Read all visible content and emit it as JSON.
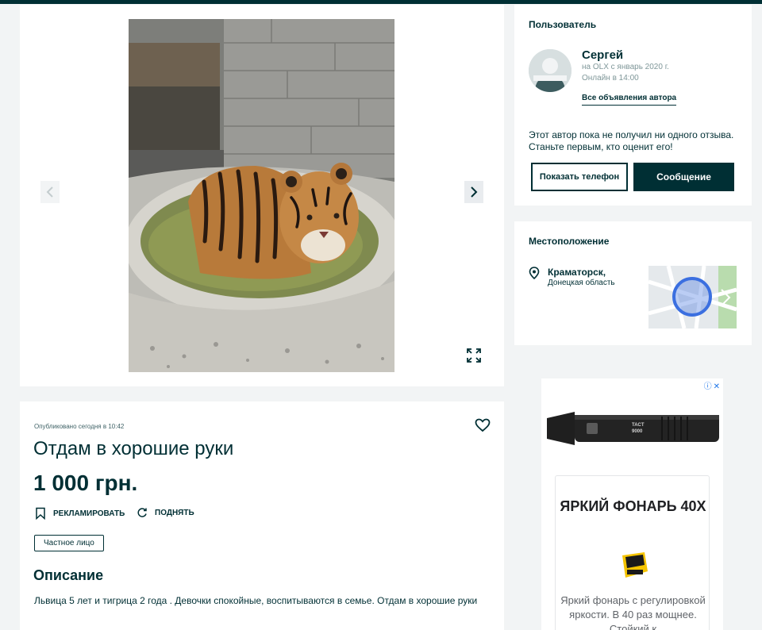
{
  "gallery": {
    "photo_label": "",
    "icons": {
      "prev": "chevron-left-icon",
      "next": "chevron-right-icon",
      "fullscreen": "expand-icon"
    }
  },
  "user": {
    "section_title": "Пользователь",
    "name": "Сергей",
    "since": "на OLX с январь 2020 г.",
    "online": "Онлайн в 14:00",
    "all_ads_link": "Все объявления автора",
    "review_text": "Этот автор пока не получил ни одного отзыва. Станьте первым, кто оценит его!",
    "phone_button": "Показать телефон",
    "message_button": "Сообщение"
  },
  "location": {
    "section_title": "Местоположение",
    "city": "Краматорск,",
    "region": "Донецкая область"
  },
  "listing": {
    "posted": "Опубликовано сегодня в 10:42",
    "title": "Отдам в хорошие руки",
    "price": "1 000 грн.",
    "promote": "РЕКЛАМИРОВАТЬ",
    "raise": "ПОДНЯТЬ",
    "seller_type": "Частное лицо",
    "description_title": "Описание",
    "description": "Львица 5 лет и тигрица 2 года . Девочки спокойные, воспитываются в семье. Отдам в хорошие руки"
  },
  "ad": {
    "choices": "ⓘ✕",
    "title": "ЯРКИЙ ФОНАРЬ 40Х",
    "product_label": "TACT 9000",
    "text": "Яркий фонарь с регулировкой яркости. В 40 раз мощнее. Стойкий к"
  },
  "colors": {
    "brand": "#002f34",
    "background": "#f2f4f5",
    "map_marker": "#3b6fe0"
  }
}
